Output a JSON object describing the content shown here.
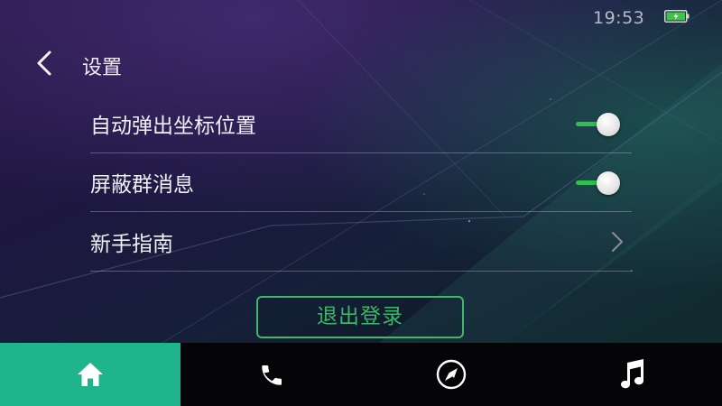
{
  "status_bar": {
    "time": "19:53",
    "battery_icon": "battery-charging-icon",
    "battery_color": "#3ec24a"
  },
  "header": {
    "back_icon": "chevron-left-icon",
    "title": "设置"
  },
  "settings": {
    "items": [
      {
        "label": "自动弹出坐标位置",
        "control": "toggle",
        "enabled": true
      },
      {
        "label": "屏蔽群消息",
        "control": "toggle",
        "enabled": true
      },
      {
        "label": "新手指南",
        "control": "chevron",
        "icon": "chevron-right-icon"
      }
    ]
  },
  "logout": {
    "label": "退出登录"
  },
  "bottom_nav": {
    "items": [
      {
        "icon": "home-icon",
        "active": true
      },
      {
        "icon": "phone-icon",
        "active": false
      },
      {
        "icon": "navigation-icon",
        "active": false
      },
      {
        "icon": "music-note-icon",
        "active": false
      }
    ]
  },
  "colors": {
    "accent_green": "#3fb86a",
    "toggle_on": "#2fbf4e",
    "nav_active": "#1fb48c",
    "nav_background": "#050507",
    "logout_text": "#3cb56b"
  }
}
